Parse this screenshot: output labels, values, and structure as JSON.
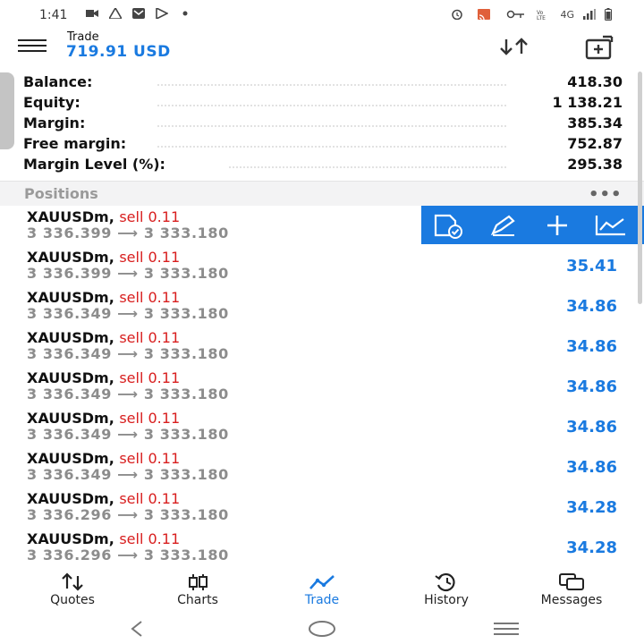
{
  "status_bar": {
    "time": "1:41",
    "network_label": "4G"
  },
  "header": {
    "title": "Trade",
    "balance": "719.91 USD"
  },
  "summary": [
    {
      "label": "Balance:",
      "value": "418.30"
    },
    {
      "label": "Equity:",
      "value": "1 138.21"
    },
    {
      "label": "Margin:",
      "value": "385.34"
    },
    {
      "label": "Free margin:",
      "value": "752.87"
    },
    {
      "label": "Margin Level (%):",
      "value": "295.38"
    }
  ],
  "positions": {
    "title": "Positions",
    "more": "•••",
    "rows": [
      {
        "symbol": "XAUUSDm,",
        "side": "sell 0.11",
        "prices": "3 336.399 ⟶ 3 333.180",
        "profit": ""
      },
      {
        "symbol": "XAUUSDm,",
        "side": "sell 0.11",
        "prices": "3 336.399 ⟶ 3 333.180",
        "profit": "35.41"
      },
      {
        "symbol": "XAUUSDm,",
        "side": "sell 0.11",
        "prices": "3 336.349 ⟶ 3 333.180",
        "profit": "34.86"
      },
      {
        "symbol": "XAUUSDm,",
        "side": "sell 0.11",
        "prices": "3 336.349 ⟶ 3 333.180",
        "profit": "34.86"
      },
      {
        "symbol": "XAUUSDm,",
        "side": "sell 0.11",
        "prices": "3 336.349 ⟶ 3 333.180",
        "profit": "34.86"
      },
      {
        "symbol": "XAUUSDm,",
        "side": "sell 0.11",
        "prices": "3 336.349 ⟶ 3 333.180",
        "profit": "34.86"
      },
      {
        "symbol": "XAUUSDm,",
        "side": "sell 0.11",
        "prices": "3 336.349 ⟶ 3 333.180",
        "profit": "34.86"
      },
      {
        "symbol": "XAUUSDm,",
        "side": "sell 0.11",
        "prices": "3 336.296 ⟶ 3 333.180",
        "profit": "34.28"
      },
      {
        "symbol": "XAUUSDm,",
        "side": "sell 0.11",
        "prices": "3 336.296 ⟶ 3 333.180",
        "profit": "34.28"
      }
    ],
    "row_actions": [
      "close-position-icon",
      "modify-pencil-icon",
      "add-plus-icon",
      "chart-icon"
    ]
  },
  "bottom_nav": [
    {
      "label": "Quotes",
      "icon": "quotes-arrows-icon"
    },
    {
      "label": "Charts",
      "icon": "charts-candles-icon"
    },
    {
      "label": "Trade",
      "icon": "trade-line-icon",
      "active": true
    },
    {
      "label": "History",
      "icon": "history-clock-icon"
    },
    {
      "label": "Messages",
      "icon": "messages-bubble-icon"
    }
  ],
  "colors": {
    "accent": "#1a7ae0",
    "sell": "#d81e1e",
    "muted": "#8c8c8c"
  }
}
